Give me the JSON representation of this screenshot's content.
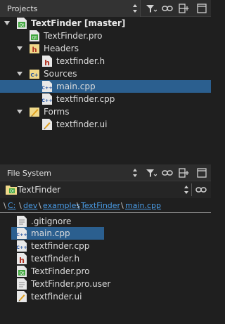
{
  "projects": {
    "title": "Projects",
    "tree": [
      {
        "label": "TextFinder [master]",
        "icon": "qt-project-icon",
        "expanded": true,
        "depth": 0
      },
      {
        "label": "TextFinder.pro",
        "icon": "pro-file-icon",
        "depth": 1
      },
      {
        "label": "Headers",
        "icon": "headers-folder-icon",
        "expanded": true,
        "depth": 1
      },
      {
        "label": "textfinder.h",
        "icon": "header-file-icon",
        "depth": 2
      },
      {
        "label": "Sources",
        "icon": "sources-folder-icon",
        "expanded": true,
        "depth": 1
      },
      {
        "label": "main.cpp",
        "icon": "cpp-file-icon",
        "depth": 2,
        "selected": true
      },
      {
        "label": "textfinder.cpp",
        "icon": "cpp-file-icon",
        "depth": 2
      },
      {
        "label": "Forms",
        "icon": "forms-folder-icon",
        "expanded": true,
        "depth": 1
      },
      {
        "label": "textfinder.ui",
        "icon": "ui-file-icon",
        "depth": 2
      }
    ]
  },
  "filesystem": {
    "title": "File System",
    "root_combo": "TextFinder",
    "breadcrumb": [
      "C:",
      "dev",
      "examples",
      "TextFinder",
      "main.cpp"
    ],
    "files": [
      {
        "label": ".gitignore",
        "icon": "text-file-icon"
      },
      {
        "label": "main.cpp",
        "icon": "cpp-file-icon",
        "selected": true
      },
      {
        "label": "textfinder.cpp",
        "icon": "cpp-file-icon"
      },
      {
        "label": "textfinder.h",
        "icon": "header-file-icon"
      },
      {
        "label": "TextFinder.pro",
        "icon": "pro-file-icon"
      },
      {
        "label": "TextFinder.pro.user",
        "icon": "text-file-icon"
      },
      {
        "label": "textfinder.ui",
        "icon": "ui-file-icon"
      }
    ]
  },
  "colors": {
    "background": "#1f1f1f",
    "selection": "#2b5f8f",
    "link": "#4a9de8",
    "header": "#2d2d2d"
  }
}
